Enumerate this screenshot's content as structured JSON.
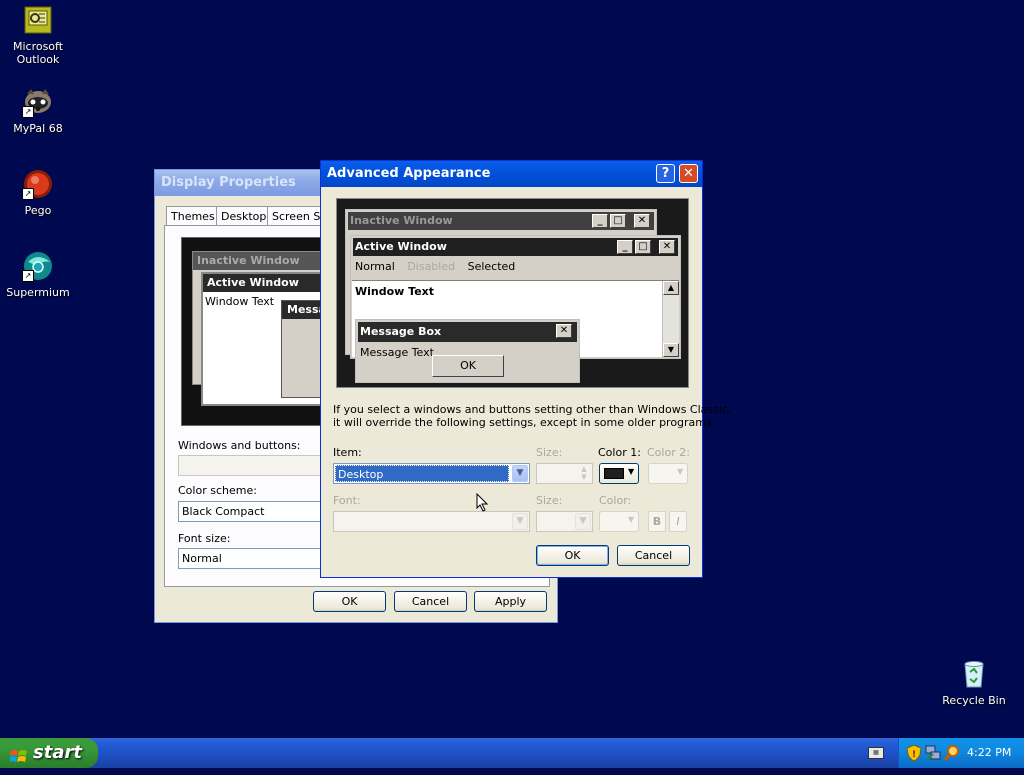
{
  "desktop": {
    "icons": [
      {
        "label_line1": "Microsoft",
        "label_line2": "Outlook"
      },
      {
        "label_line1": "MyPal 68",
        "label_line2": ""
      },
      {
        "label_line1": "Pego",
        "label_line2": ""
      },
      {
        "label_line1": "Supermium",
        "label_line2": ""
      },
      {
        "label_line1": "Recycle Bin",
        "label_line2": ""
      }
    ]
  },
  "display_properties": {
    "title": "Display Properties",
    "tabs": [
      "Themes",
      "Desktop",
      "Screen Sa"
    ],
    "preview": {
      "inactive_title": "Inactive Window",
      "active_title": "Active Window",
      "window_text": "Window Text",
      "message_title": "Messa"
    },
    "windows_and_buttons_label": "Windows and buttons:",
    "windows_and_buttons_value": "",
    "color_scheme_label": "Color scheme:",
    "color_scheme_value": "Black Compact",
    "font_size_label": "Font size:",
    "font_size_value": "Normal",
    "ok": "OK",
    "cancel": "Cancel",
    "apply": "Apply"
  },
  "advanced_appearance": {
    "title": "Advanced Appearance",
    "help_glyph": "?",
    "close_glyph": "✕",
    "preview": {
      "inactive_title": "Inactive Window",
      "active_title": "Active Window",
      "menu_normal": "Normal",
      "menu_disabled": "Disabled",
      "menu_selected": "Selected",
      "window_text": "Window Text",
      "message_title": "Message Box",
      "message_text": "Message Text",
      "message_ok": "OK"
    },
    "info_line1": "If you select a windows and buttons setting other than Windows Classic,",
    "info_line2": "it will override the following settings, except in some older programs.",
    "item_label": "Item:",
    "item_value": "Desktop",
    "size_label": "Size:",
    "color1_label": "Color 1:",
    "color1_value": "#1f1f1f",
    "color2_label": "Color 2:",
    "font_label": "Font:",
    "font_size_label": "Size:",
    "font_color_label": "Color:",
    "bold_label": "B",
    "italic_label": "I",
    "ok": "OK",
    "cancel": "Cancel"
  },
  "taskbar": {
    "start_label": "start",
    "clock": "4:22 PM",
    "tray_icons": [
      "keyboard-icon",
      "security-shield-icon",
      "network-icon",
      "search-icon"
    ]
  },
  "colors": {
    "desktop_background": "#000950",
    "xp_blue": "#0352dc",
    "preview_dark": "#1a1a1a"
  }
}
